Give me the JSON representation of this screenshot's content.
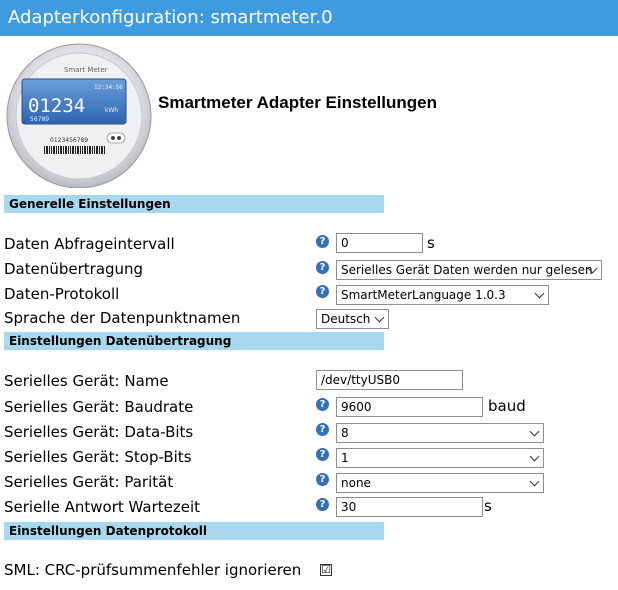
{
  "window": {
    "title": "Adapterkonfiguration: smartmeter.0"
  },
  "meter_image": {
    "brand": "Smart Meter",
    "time": "12:34:56",
    "reading": "01234",
    "unit": "kWh",
    "sub": "56789",
    "barcode": "0123456789"
  },
  "page_title": "Smartmeter Adapter Einstellungen",
  "sections": {
    "general": "Generelle Einstellungen",
    "transfer": "Einstellungen Datenübertragung",
    "protocol": "Einstellungen Datenprotokoll"
  },
  "general": {
    "interval_label": "Daten Abfrageintervall",
    "interval_value": "0",
    "interval_unit": "s",
    "transfer_label": "Datenübertragung",
    "transfer_value": "Serielles Gerät Daten werden nur gelesen",
    "protocol_label": "Daten-Protokoll",
    "protocol_value": "SmartMeterLanguage 1.0.3",
    "language_label": "Sprache der Datenpunktnamen",
    "language_value": "Deutsch"
  },
  "transfer": {
    "device_label": "Serielles Gerät: Name",
    "device_value": "/dev/ttyUSB0",
    "baud_label": "Serielles Gerät: Baudrate",
    "baud_value": "9600",
    "baud_unit": "baud",
    "databits_label": "Serielles Gerät: Data-Bits",
    "databits_value": "8",
    "stopbits_label": "Serielles Gerät: Stop-Bits",
    "stopbits_value": "1",
    "parity_label": "Serielles Gerät: Parität",
    "parity_value": "none",
    "wait_label": "Serielle Antwort Wartezeit",
    "wait_value": "30",
    "wait_unit": "s"
  },
  "protocol": {
    "crc_label": "SML: CRC-prüfsummenfehler ignorieren",
    "crc_checked": "☑"
  },
  "icons": {
    "help": "?"
  },
  "colors": {
    "titlebar": "#3f9be0",
    "section": "#a8d8ee",
    "help": "#3370b8"
  }
}
